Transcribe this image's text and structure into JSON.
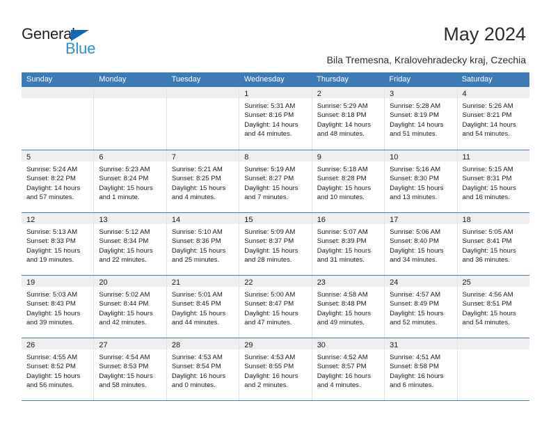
{
  "brand": {
    "name_part1": "General",
    "name_part2": "Blue",
    "triangle_color": "#1268b3",
    "blue_text_color": "#2f8fd6"
  },
  "header": {
    "title": "May 2024",
    "subtitle": "Bila Tremesna, Kralovehradecky kraj, Czechia"
  },
  "theme": {
    "header_band": "#3b7cb8",
    "date_strip": "#efefef",
    "grid_line": "#e3e3e3",
    "text": "#1a1a1a"
  },
  "weekdays": [
    "Sunday",
    "Monday",
    "Tuesday",
    "Wednesday",
    "Thursday",
    "Friday",
    "Saturday"
  ],
  "weeks": [
    [
      {
        "day": "",
        "empty": true,
        "lines": []
      },
      {
        "day": "",
        "empty": true,
        "lines": []
      },
      {
        "day": "",
        "empty": true,
        "lines": []
      },
      {
        "day": "1",
        "lines": [
          "Sunrise: 5:31 AM",
          "Sunset: 8:16 PM",
          "Daylight: 14 hours",
          "and 44 minutes."
        ]
      },
      {
        "day": "2",
        "lines": [
          "Sunrise: 5:29 AM",
          "Sunset: 8:18 PM",
          "Daylight: 14 hours",
          "and 48 minutes."
        ]
      },
      {
        "day": "3",
        "lines": [
          "Sunrise: 5:28 AM",
          "Sunset: 8:19 PM",
          "Daylight: 14 hours",
          "and 51 minutes."
        ]
      },
      {
        "day": "4",
        "lines": [
          "Sunrise: 5:26 AM",
          "Sunset: 8:21 PM",
          "Daylight: 14 hours",
          "and 54 minutes."
        ]
      }
    ],
    [
      {
        "day": "5",
        "lines": [
          "Sunrise: 5:24 AM",
          "Sunset: 8:22 PM",
          "Daylight: 14 hours",
          "and 57 minutes."
        ]
      },
      {
        "day": "6",
        "lines": [
          "Sunrise: 5:23 AM",
          "Sunset: 8:24 PM",
          "Daylight: 15 hours",
          "and 1 minute."
        ]
      },
      {
        "day": "7",
        "lines": [
          "Sunrise: 5:21 AM",
          "Sunset: 8:25 PM",
          "Daylight: 15 hours",
          "and 4 minutes."
        ]
      },
      {
        "day": "8",
        "lines": [
          "Sunrise: 5:19 AM",
          "Sunset: 8:27 PM",
          "Daylight: 15 hours",
          "and 7 minutes."
        ]
      },
      {
        "day": "9",
        "lines": [
          "Sunrise: 5:18 AM",
          "Sunset: 8:28 PM",
          "Daylight: 15 hours",
          "and 10 minutes."
        ]
      },
      {
        "day": "10",
        "lines": [
          "Sunrise: 5:16 AM",
          "Sunset: 8:30 PM",
          "Daylight: 15 hours",
          "and 13 minutes."
        ]
      },
      {
        "day": "11",
        "lines": [
          "Sunrise: 5:15 AM",
          "Sunset: 8:31 PM",
          "Daylight: 15 hours",
          "and 16 minutes."
        ]
      }
    ],
    [
      {
        "day": "12",
        "lines": [
          "Sunrise: 5:13 AM",
          "Sunset: 8:33 PM",
          "Daylight: 15 hours",
          "and 19 minutes."
        ]
      },
      {
        "day": "13",
        "lines": [
          "Sunrise: 5:12 AM",
          "Sunset: 8:34 PM",
          "Daylight: 15 hours",
          "and 22 minutes."
        ]
      },
      {
        "day": "14",
        "lines": [
          "Sunrise: 5:10 AM",
          "Sunset: 8:36 PM",
          "Daylight: 15 hours",
          "and 25 minutes."
        ]
      },
      {
        "day": "15",
        "lines": [
          "Sunrise: 5:09 AM",
          "Sunset: 8:37 PM",
          "Daylight: 15 hours",
          "and 28 minutes."
        ]
      },
      {
        "day": "16",
        "lines": [
          "Sunrise: 5:07 AM",
          "Sunset: 8:39 PM",
          "Daylight: 15 hours",
          "and 31 minutes."
        ]
      },
      {
        "day": "17",
        "lines": [
          "Sunrise: 5:06 AM",
          "Sunset: 8:40 PM",
          "Daylight: 15 hours",
          "and 34 minutes."
        ]
      },
      {
        "day": "18",
        "lines": [
          "Sunrise: 5:05 AM",
          "Sunset: 8:41 PM",
          "Daylight: 15 hours",
          "and 36 minutes."
        ]
      }
    ],
    [
      {
        "day": "19",
        "lines": [
          "Sunrise: 5:03 AM",
          "Sunset: 8:43 PM",
          "Daylight: 15 hours",
          "and 39 minutes."
        ]
      },
      {
        "day": "20",
        "lines": [
          "Sunrise: 5:02 AM",
          "Sunset: 8:44 PM",
          "Daylight: 15 hours",
          "and 42 minutes."
        ]
      },
      {
        "day": "21",
        "lines": [
          "Sunrise: 5:01 AM",
          "Sunset: 8:45 PM",
          "Daylight: 15 hours",
          "and 44 minutes."
        ]
      },
      {
        "day": "22",
        "lines": [
          "Sunrise: 5:00 AM",
          "Sunset: 8:47 PM",
          "Daylight: 15 hours",
          "and 47 minutes."
        ]
      },
      {
        "day": "23",
        "lines": [
          "Sunrise: 4:58 AM",
          "Sunset: 8:48 PM",
          "Daylight: 15 hours",
          "and 49 minutes."
        ]
      },
      {
        "day": "24",
        "lines": [
          "Sunrise: 4:57 AM",
          "Sunset: 8:49 PM",
          "Daylight: 15 hours",
          "and 52 minutes."
        ]
      },
      {
        "day": "25",
        "lines": [
          "Sunrise: 4:56 AM",
          "Sunset: 8:51 PM",
          "Daylight: 15 hours",
          "and 54 minutes."
        ]
      }
    ],
    [
      {
        "day": "26",
        "lines": [
          "Sunrise: 4:55 AM",
          "Sunset: 8:52 PM",
          "Daylight: 15 hours",
          "and 56 minutes."
        ]
      },
      {
        "day": "27",
        "lines": [
          "Sunrise: 4:54 AM",
          "Sunset: 8:53 PM",
          "Daylight: 15 hours",
          "and 58 minutes."
        ]
      },
      {
        "day": "28",
        "lines": [
          "Sunrise: 4:53 AM",
          "Sunset: 8:54 PM",
          "Daylight: 16 hours",
          "and 0 minutes."
        ]
      },
      {
        "day": "29",
        "lines": [
          "Sunrise: 4:53 AM",
          "Sunset: 8:55 PM",
          "Daylight: 16 hours",
          "and 2 minutes."
        ]
      },
      {
        "day": "30",
        "lines": [
          "Sunrise: 4:52 AM",
          "Sunset: 8:57 PM",
          "Daylight: 16 hours",
          "and 4 minutes."
        ]
      },
      {
        "day": "31",
        "lines": [
          "Sunrise: 4:51 AM",
          "Sunset: 8:58 PM",
          "Daylight: 16 hours",
          "and 6 minutes."
        ]
      },
      {
        "day": "",
        "empty": true,
        "lines": []
      }
    ]
  ]
}
